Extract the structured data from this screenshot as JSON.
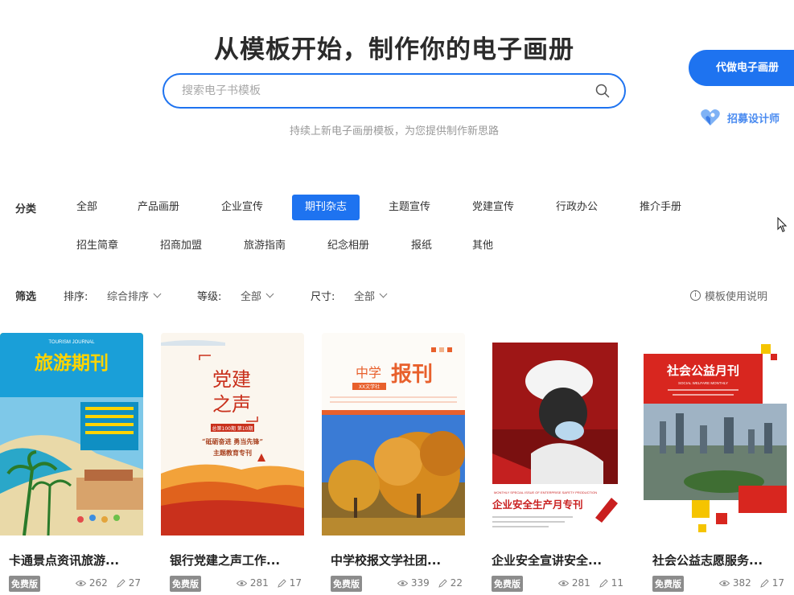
{
  "hero": {
    "title": "从模板开始，制作你的电子画册",
    "search_placeholder": "搜索电子书模板",
    "subtitle": "持续上新电子画册模板，为您提供制作新思路"
  },
  "side": {
    "custom_button": "代做电子画册",
    "recruit_link": "招募设计师"
  },
  "categories": {
    "label": "分类",
    "items": [
      "全部",
      "产品画册",
      "企业宣传",
      "期刊杂志",
      "主题宣传",
      "党建宣传",
      "行政办公",
      "推介手册",
      "招生简章",
      "招商加盟",
      "旅游指南",
      "纪念相册",
      "报纸",
      "其他"
    ],
    "active": "期刊杂志"
  },
  "filters": {
    "label": "筛选",
    "sort_key": "排序:",
    "sort_value": "综合排序",
    "level_key": "等级:",
    "level_value": "全部",
    "size_key": "尺寸:",
    "size_value": "全部",
    "help": "模板使用说明"
  },
  "cards": [
    {
      "title": "卡通景点资讯旅游...",
      "badge": "免费版",
      "views": "262",
      "edits": "27",
      "cover": {
        "heading": "旅游期刊",
        "kicker": "TOURISM JOURNAL",
        "colors": [
          "#ffd400",
          "#1a9fd8"
        ]
      }
    },
    {
      "title": "银行党建之声工作...",
      "badge": "免费版",
      "views": "281",
      "edits": "17",
      "cover": {
        "heading_line1": "党建",
        "heading_line2": "之声",
        "tag": "总第100期 第10期",
        "quote": "“砥砺奋进 勇当先锋”",
        "quote2": "主题教育专刊",
        "colors": [
          "#c9301c",
          "#f2a23a"
        ]
      }
    },
    {
      "title": "中学校报文学社团...",
      "badge": "免费版",
      "views": "339",
      "edits": "22",
      "cover": {
        "heading_a": "中学",
        "heading_b": "报刊",
        "tag": "XX文学社",
        "colors": [
          "#e8602c",
          "#3a7bd5"
        ]
      }
    },
    {
      "title": "企业安全宣讲安全...",
      "badge": "免费版",
      "views": "281",
      "edits": "11",
      "cover": {
        "kicker": "MONTHLY SPECIAL ISSUE OF ENTERPRISE SAFETY PRODUCTION",
        "heading": "企业安全生产月专刊",
        "colors": [
          "#c91f1f",
          "#ffffff"
        ]
      }
    },
    {
      "title": "社会公益志愿服务...",
      "badge": "免费版",
      "views": "382",
      "edits": "17",
      "cover": {
        "heading": "社会公益月刊",
        "kicker": "SOCIAL WELFARE MONTHLY",
        "colors": [
          "#d8261f",
          "#f5c400"
        ]
      }
    }
  ]
}
